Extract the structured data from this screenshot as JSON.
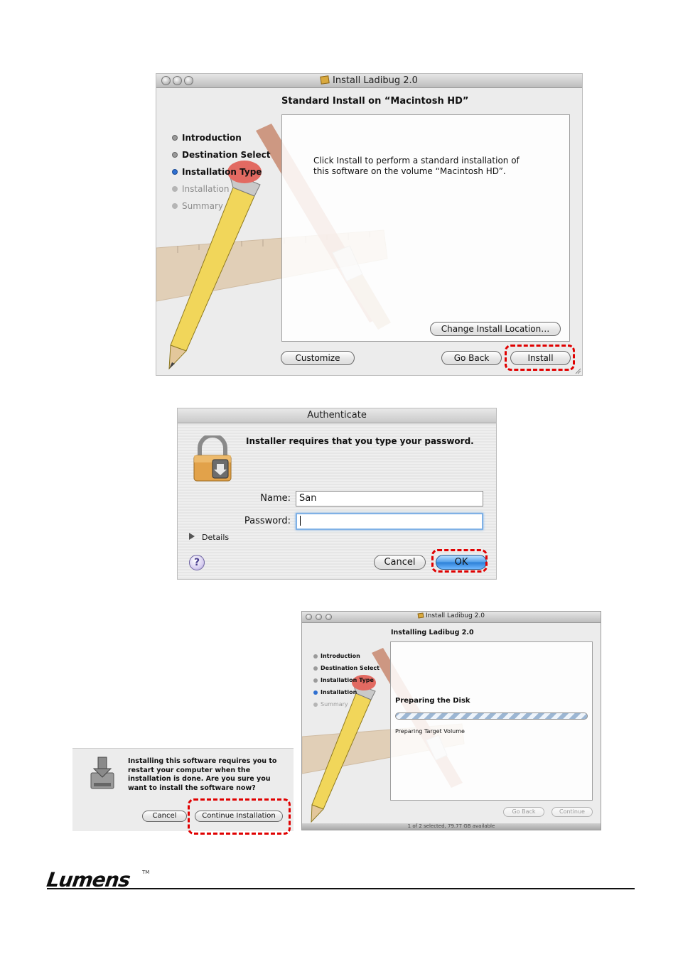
{
  "installer": {
    "window_title": "Install Ladibug 2.0",
    "heading": "Standard Install on “Macintosh HD”",
    "steps": [
      {
        "label": "Introduction",
        "state": "done"
      },
      {
        "label": "Destination Select",
        "state": "done"
      },
      {
        "label": "Installation Type",
        "state": "current"
      },
      {
        "label": "Installation",
        "state": "pending"
      },
      {
        "label": "Summary",
        "state": "pending"
      }
    ],
    "message_line1": "Click Install to perform a standard installation of",
    "message_line2": "this software on the volume “Macintosh HD”.",
    "change_location_label": "Change Install Location…",
    "customize_label": "Customize",
    "go_back_label": "Go Back",
    "install_label": "Install"
  },
  "authenticate": {
    "window_title": "Authenticate",
    "message": "Installer requires that you type your password.",
    "name_label": "Name:",
    "name_value": "San",
    "password_label": "Password:",
    "password_value": "",
    "details_label": "Details",
    "help_label": "?",
    "cancel_label": "Cancel",
    "ok_label": "OK"
  },
  "restart_dialog": {
    "message_lines": [
      "Installing this software requires you to",
      "restart your computer when the",
      "installation is done. Are you sure you",
      "want to install the software now?"
    ],
    "cancel_label": "Cancel",
    "continue_label": "Continue Installation"
  },
  "installing": {
    "window_title": "Install Ladibug 2.0",
    "heading": "Installing Ladibug 2.0",
    "steps": [
      {
        "label": "Introduction",
        "state": "done"
      },
      {
        "label": "Destination Select",
        "state": "done"
      },
      {
        "label": "Installation Type",
        "state": "done"
      },
      {
        "label": "Installation",
        "state": "current"
      },
      {
        "label": "Summary",
        "state": "pending"
      }
    ],
    "status_title": "Preparing the Disk",
    "status_detail": "Preparing Target Volume",
    "progress_fraction": 1.0,
    "go_back_label": "Go Back",
    "continue_label": "Continue",
    "footer_status": "1 of 2 selected, 79.77 GB available"
  },
  "footer": {
    "logo_text": "Lumens",
    "trademark": "TM"
  },
  "colors": {
    "highlight_dash": "#e00000",
    "current_step_bullet": "#2f6fd0",
    "ok_button_blue": "#2b7fd6"
  }
}
